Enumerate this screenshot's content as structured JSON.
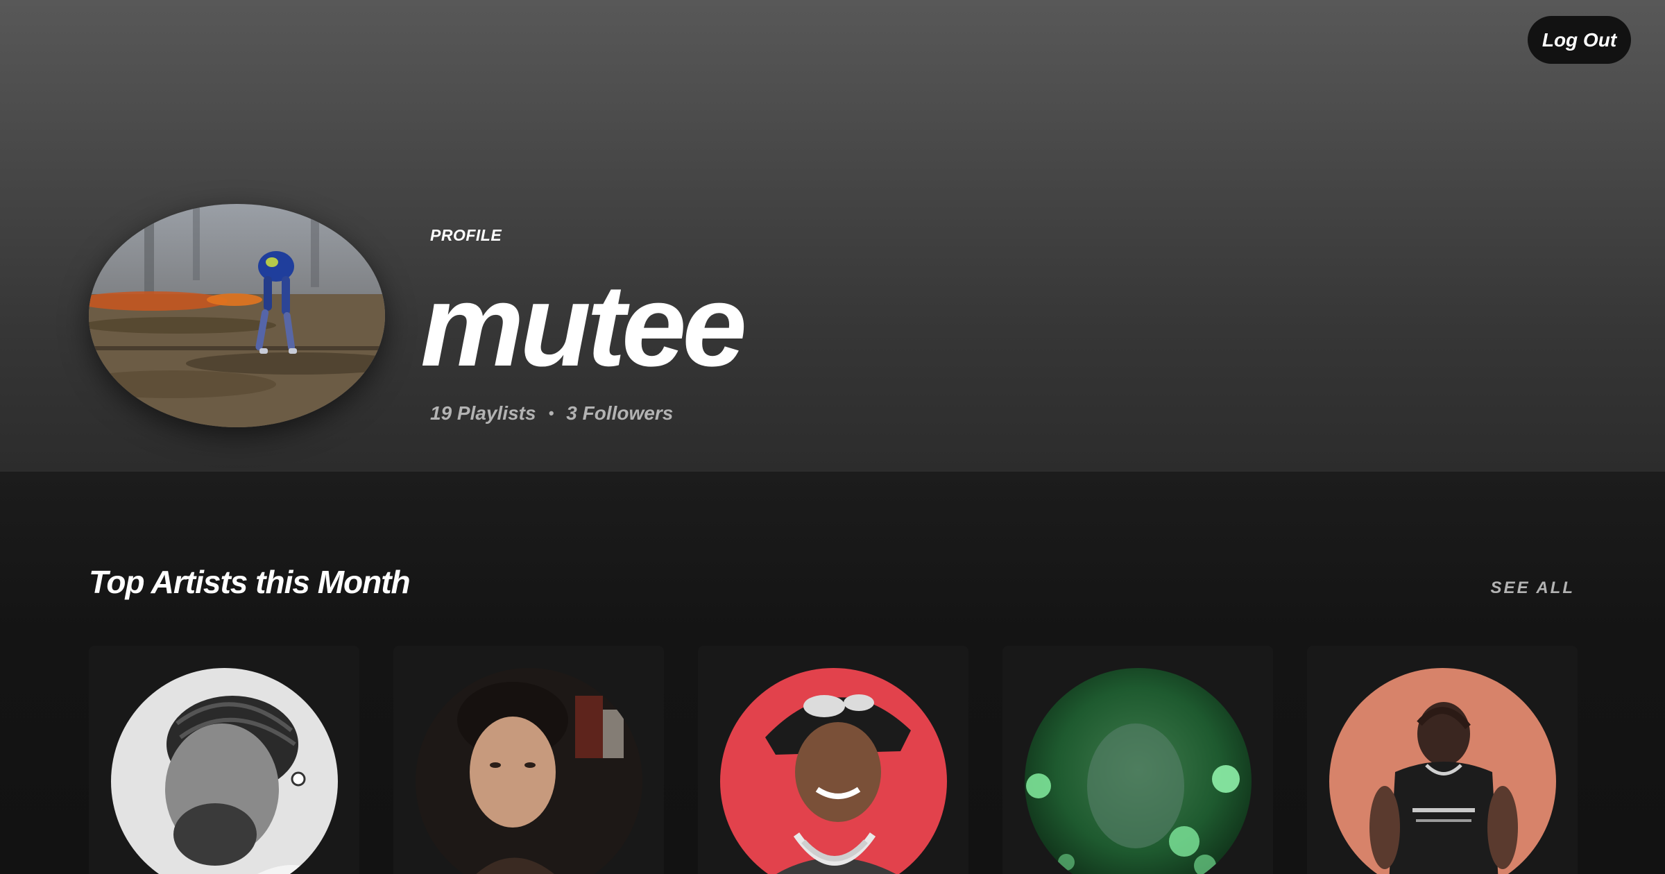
{
  "header": {
    "logout_label": "Log Out"
  },
  "profile": {
    "label": "PROFILE",
    "username": "mutee",
    "playlists": "19 Playlists",
    "separator": "•",
    "followers": "3 Followers",
    "avatar_icon": "profile-photo-robot"
  },
  "section": {
    "title": "Top Artists this Month",
    "see_all_label": "SEE ALL"
  },
  "artists": [
    {
      "icon": "artist-photo-1",
      "tone": "#d9d9d9"
    },
    {
      "icon": "artist-photo-2",
      "tone": "#2a2320"
    },
    {
      "icon": "artist-photo-3",
      "tone": "#e0454d"
    },
    {
      "icon": "artist-photo-4",
      "tone": "#1f6b35"
    },
    {
      "icon": "artist-photo-5",
      "tone": "#d98a6c"
    }
  ],
  "colors": {
    "background": "#121212",
    "card": "#181818",
    "muted_text": "#b3b3b3",
    "hero_top": "#585858"
  }
}
